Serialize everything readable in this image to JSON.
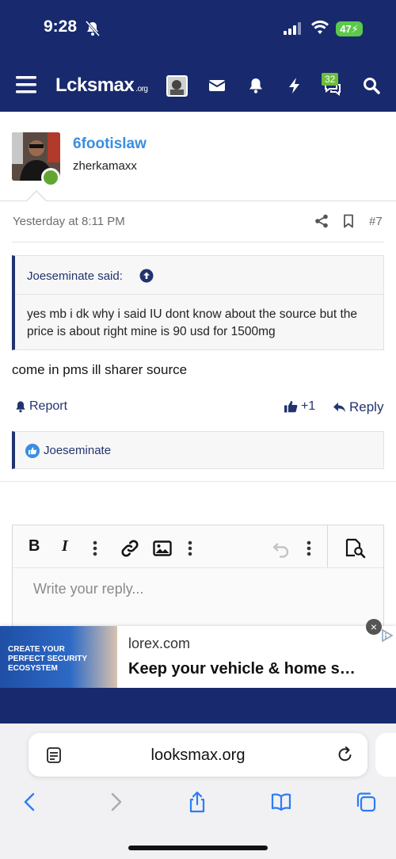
{
  "status_bar": {
    "time": "9:28",
    "battery": "47"
  },
  "header": {
    "logo": "Lcksmax",
    "logo_suffix": ".org",
    "conversations_badge": "32"
  },
  "post": {
    "username": "6footislaw",
    "user_title": "zherkamaxx",
    "timestamp": "Yesterday at 8:11 PM",
    "post_number": "#7",
    "quote": {
      "author": "Joeseminate said:",
      "text": "yes mb i dk why i said IU dont know about the source but the price is about right mine is 90 usd for 1500mg"
    },
    "body": "come in pms ill sharer source",
    "actions": {
      "report": "Report",
      "like_count": "+1",
      "reply": "Reply"
    },
    "reactions": {
      "user": "Joeseminate"
    }
  },
  "editor": {
    "placeholder": "Write your reply..."
  },
  "ad": {
    "domain": "lorex.com",
    "title": "Keep your vehicle & home s…",
    "image_text": "CREATE YOUR PERFECT SECURITY ECOSYSTEM"
  },
  "browser": {
    "url": "looksmax.org"
  },
  "colors": {
    "brand_navy": "#182a6d",
    "link_blue": "#3a8ee0",
    "online_green": "#63a532"
  }
}
